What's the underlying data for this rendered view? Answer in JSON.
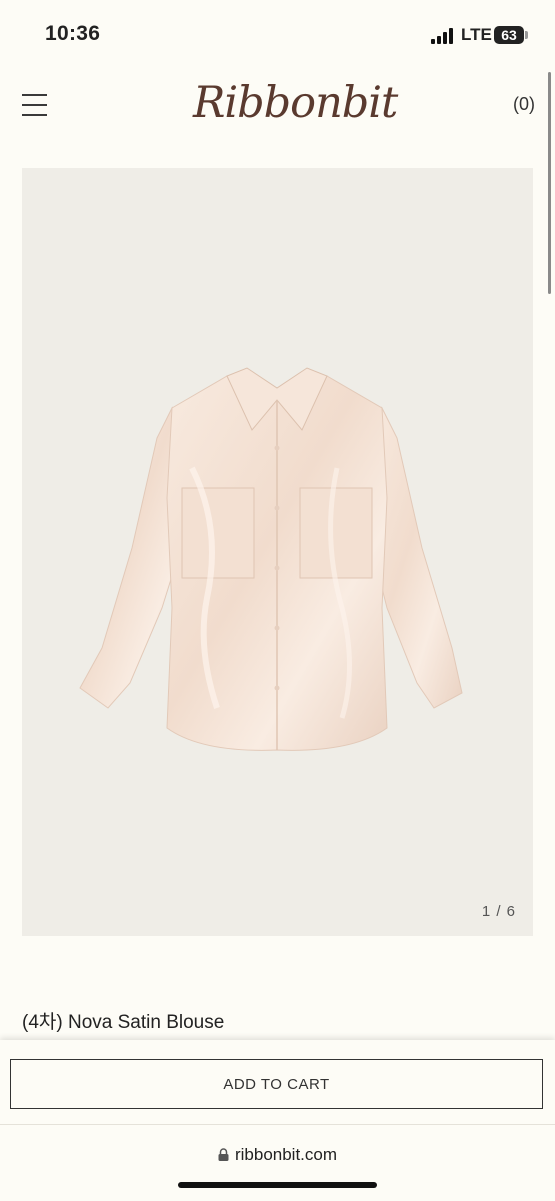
{
  "status_bar": {
    "time": "10:36",
    "network": "LTE",
    "battery": "63"
  },
  "header": {
    "logo": "Ribbonbit",
    "cart_count": "(0)",
    "menu_icon": "hamburger-menu-icon"
  },
  "product": {
    "image_counter": "1 / 6",
    "title": "(4차) Nova Satin Blouse",
    "image_colors": {
      "background": "#efede7",
      "garment": "#f6e4d8"
    }
  },
  "actions": {
    "add_to_cart": "ADD TO CART"
  },
  "browser": {
    "url": "ribbonbit.com"
  }
}
